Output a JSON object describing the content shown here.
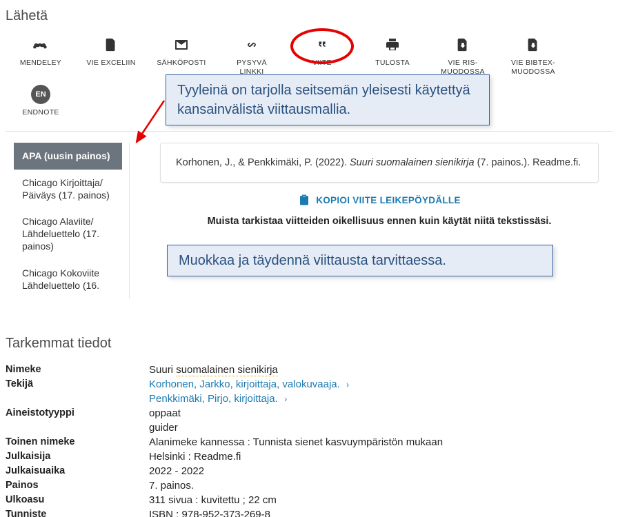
{
  "send": {
    "title": "Lähetä",
    "actions": [
      {
        "id": "mendeley",
        "label": "MENDELEY"
      },
      {
        "id": "excel",
        "label": "VIE EXCELIIN"
      },
      {
        "id": "email",
        "label": "SÄHKÖPOSTI"
      },
      {
        "id": "permalink",
        "label": "PYSYVÄ\nLINKKI"
      },
      {
        "id": "cite",
        "label": "VIITE"
      },
      {
        "id": "print",
        "label": "TULOSTA"
      },
      {
        "id": "ris",
        "label": "VIE RIS-\nMUODOSSA"
      },
      {
        "id": "bibtex",
        "label": "VIE BIBTEX-\nMUODOSSA"
      },
      {
        "id": "endnote",
        "label": "ENDNOTE"
      }
    ]
  },
  "annotations": {
    "callout1": "Tyyleinä on tarjolla seitsemän yleisesti käytettyä kansainvälistä viittausmallia.",
    "callout2": "Muokkaa ja täydennä viittausta tarvittaessa."
  },
  "citation": {
    "styles": [
      {
        "id": "apa",
        "label": "APA (uusin painos)",
        "active": true
      },
      {
        "id": "chi-ad",
        "label": "Chicago Kirjoittaja/\nPäiväys (17. painos)"
      },
      {
        "id": "chi-fn",
        "label": "Chicago Alaviite/\nLähdeluettelo (17. painos)"
      },
      {
        "id": "chi-full",
        "label": "Chicago Kokoviite\nLähdeluettelo (16."
      }
    ],
    "text_pre": "Korhonen, J., & Penkkimäki, P. (2022). ",
    "text_title": "Suuri suomalainen sienikirja",
    "text_post": " (7. painos.). Readme.fi.",
    "copy_label": "KOPIOI VIITE LEIKEPÖYDÄLLE",
    "reminder": "Muista tarkistaa viitteiden oikellisuus ennen kuin käytät niitä tekstissäsi."
  },
  "details": {
    "title": "Tarkemmat tiedot",
    "rows": {
      "nimeke": {
        "label": "Nimeke",
        "value_pre": "Suuri ",
        "value_hl": "suomalainen sienikirja"
      },
      "tekija1": {
        "label": "Tekijä",
        "value": "Korhonen, Jarkko, kirjoittaja, valokuvaaja."
      },
      "tekija2": {
        "label": "",
        "value": "Penkkimäki, Pirjo, kirjoittaja."
      },
      "aineisto1": {
        "label": "Aineistotyyppi",
        "value": "oppaat"
      },
      "aineisto2": {
        "label": "",
        "value": "guider"
      },
      "toinen": {
        "label": "Toinen nimeke",
        "value": "Alanimeke kannessa : Tunnista sienet kasvuympäristön mukaan"
      },
      "julkaisija": {
        "label": "Julkaisija",
        "value": "Helsinki : Readme.fi"
      },
      "julkaisuaika": {
        "label": "Julkaisuaika",
        "value": "2022 - 2022"
      },
      "painos": {
        "label": "Painos",
        "value": "7. painos."
      },
      "ulkoasu": {
        "label": "Ulkoasu",
        "value": "311 sivua : kuvitettu ; 22 cm"
      },
      "tunniste": {
        "label": "Tunniste",
        "value": "ISBN : 978-952-373-269-8"
      }
    }
  }
}
